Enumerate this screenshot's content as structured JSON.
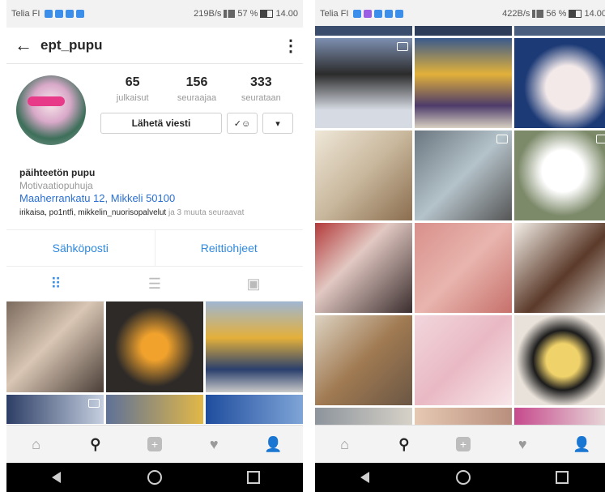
{
  "left": {
    "status": {
      "carrier": "Telia FI",
      "network": "219B/s",
      "battery": "57 %",
      "time": "14.00"
    },
    "header": {
      "username": "ept_pupu"
    },
    "stats": [
      {
        "value": "65",
        "label": "julkaisut"
      },
      {
        "value": "156",
        "label": "seuraajaa"
      },
      {
        "value": "333",
        "label": "seurataan"
      }
    ],
    "message_label": "Lähetä viesti",
    "bio": {
      "name": "päihteetön pupu",
      "category": "Motivaatiopuhuja",
      "address": "Maaherrankatu 12, Mikkeli 50100",
      "followed_by_names": "irikaisa, po1ntfi, mikkelin_nuorisopalvelut",
      "followed_by_more": "ja 3 muuta seuraavat"
    },
    "contact": {
      "email": "Sähköposti",
      "directions": "Reittiohjeet"
    },
    "icons": {
      "back": "back-arrow-icon",
      "more": "more-vertical-icon"
    }
  },
  "right": {
    "status": {
      "carrier": "Telia FI",
      "network": "422B/s",
      "battery": "56 %",
      "time": "14.00"
    }
  },
  "colors": {
    "link": "#2f89e0",
    "accent": "#3b8eea",
    "text": "#262626",
    "muted": "#999999"
  }
}
